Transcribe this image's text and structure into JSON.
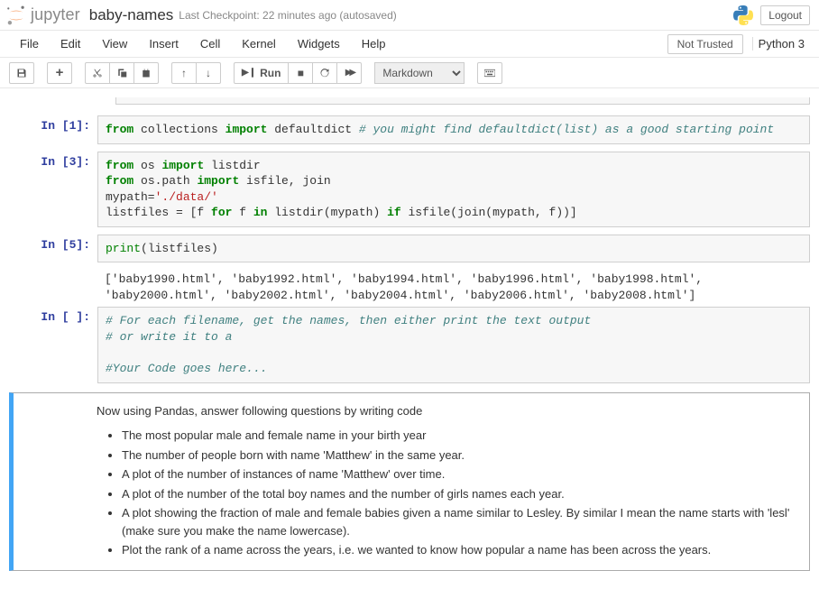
{
  "header": {
    "logo_text": "jupyter",
    "notebook_name": "baby-names",
    "checkpoint": "Last Checkpoint: 22 minutes ago  (autosaved)",
    "logout": "Logout"
  },
  "menubar": {
    "items": [
      "File",
      "Edit",
      "View",
      "Insert",
      "Cell",
      "Kernel",
      "Widgets",
      "Help"
    ],
    "not_trusted": "Not Trusted",
    "kernel": "Python 3"
  },
  "toolbar": {
    "save": "save-icon",
    "add": "+",
    "cut": "✂",
    "copy": "copy-icon",
    "paste": "paste-icon",
    "up": "↑",
    "down": "↓",
    "run": "Run",
    "stop": "■",
    "restart": "↻",
    "fastforward": "▸▸",
    "celltype": "Markdown",
    "keyboard": "keyboard-icon"
  },
  "cells": {
    "c1": {
      "prompt": "In [1]:",
      "from": "from",
      "collections": " collections ",
      "import": "import",
      "defaultdict": " defaultdict ",
      "comment": "# you might find defaultdict(list) as a good starting point"
    },
    "c3": {
      "prompt": "In [3]:",
      "l1_from": "from",
      "l1_os": " os ",
      "l1_import": "import",
      "l1_listdir": " listdir",
      "l2_from": "from",
      "l2_ospath": " os.path ",
      "l2_import": "import",
      "l2_funcs": " isfile, join",
      "l3_var": "mypath=",
      "l3_str": "'./data/'",
      "l4_pre": "listfiles = [f ",
      "l4_for": "for",
      "l4_mid": " f ",
      "l4_in": "in",
      "l4_listdir": " listdir(mypath) ",
      "l4_if": "if",
      "l4_rest": " isfile(join(mypath, f))]"
    },
    "c5": {
      "prompt": "In [5]:",
      "print": "print",
      "args": "(listfiles)",
      "output": "['baby1990.html', 'baby1992.html', 'baby1994.html', 'baby1996.html', 'baby1998.html', 'baby2000.html', 'baby2002.html', 'baby2004.html', 'baby2006.html', 'baby2008.html']"
    },
    "c6": {
      "prompt": "In [ ]:",
      "l1": "# For each filename, get the names, then either print the text output",
      "l2": "# or write it to a",
      "l3": "",
      "l4": "#Your Code goes here..."
    },
    "md": {
      "intro": "Now using Pandas, answer following questions by writing code",
      "li1": "The most popular male and female name in your birth year",
      "li2": "The number of people born with name 'Matthew' in the same year.",
      "li3": "A plot of the number of instances of name 'Matthew' over time.",
      "li4": "A plot of the number of the total boy names and the number of girls names each year.",
      "li5": "A plot showing the fraction of male and female babies given a name similar to Lesley. By similar I mean the name starts with 'lesl' (make sure you make the name lowercase).",
      "li6": "Plot the rank of a name across the years, i.e. we wanted to know how popular a name has been across the years."
    }
  }
}
